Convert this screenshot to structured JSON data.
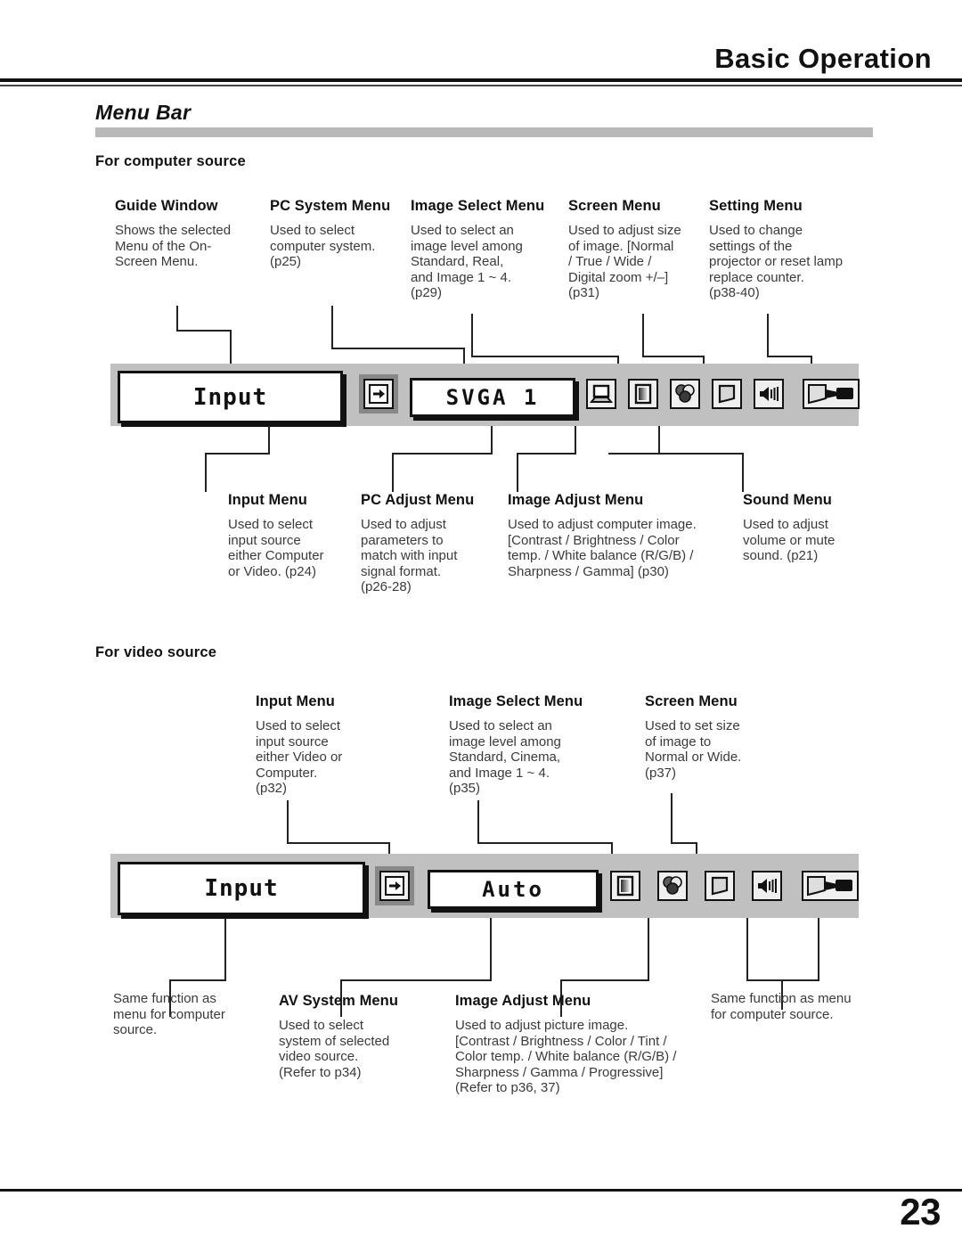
{
  "header": {
    "title": "Basic Operation"
  },
  "section": {
    "title": "Menu Bar"
  },
  "computer_section": {
    "heading": "For computer source",
    "top_callouts": [
      {
        "title": "Guide Window",
        "body": "Shows the selected\nMenu of the On-\nScreen Menu."
      },
      {
        "title": "PC System Menu",
        "body": "Used to select\ncomputer system.\n(p25)"
      },
      {
        "title": "Image Select Menu",
        "body": "Used to select  an\nimage level among\nStandard, Real,\nand Image 1 ~ 4.\n(p29)"
      },
      {
        "title": "Screen Menu",
        "body": "Used to adjust size\nof image.  [Normal\n/ True / Wide /\nDigital zoom +/–]\n(p31)"
      },
      {
        "title": "Setting Menu",
        "body": "Used to change\nsettings of the\nprojector or reset  lamp\nreplace counter.\n(p38-40)"
      }
    ],
    "bottom_callouts": [
      {
        "title": "Input Menu",
        "body": "Used to select\ninput source\neither Computer\nor Video.  (p24)"
      },
      {
        "title": "PC Adjust Menu",
        "body": "Used to adjust\nparameters to\nmatch with input\nsignal format.\n(p26-28)"
      },
      {
        "title": "Image Adjust Menu",
        "body": "Used to adjust computer image.\n[Contrast / Brightness / Color\ntemp. /  White balance (R/G/B) /\nSharpness /  Gamma]   (p30)"
      },
      {
        "title": "Sound Menu",
        "body": "Used to adjust\nvolume or mute\nsound.  (p21)"
      }
    ],
    "menu_bar": {
      "guide_label": "Input",
      "value_label": "SVGA 1",
      "icons": [
        "input-source-icon",
        "pc-system-computer-icon",
        "image-select-icon",
        "image-adjust-color-icon",
        "screen-size-icon",
        "sound-speaker-icon",
        "setting-projector-icon"
      ]
    }
  },
  "video_section": {
    "heading": "For video source",
    "top_callouts": [
      {
        "title": "Input Menu",
        "body": "Used to select\ninput source\neither Video or\nComputer.\n(p32)"
      },
      {
        "title": "Image Select Menu",
        "body": "Used to select an\nimage level among\nStandard, Cinema,\nand Image 1 ~ 4.\n(p35)"
      },
      {
        "title": "Screen Menu",
        "body": "Used to set size\nof image to\nNormal or Wide.\n(p37)"
      }
    ],
    "bottom_callouts": [
      {
        "title": "",
        "body": "Same function as\nmenu for computer\nsource."
      },
      {
        "title": "AV System Menu",
        "body": "Used to select\nsystem of selected\nvideo source.\n(Refer to p34)"
      },
      {
        "title": "Image Adjust Menu",
        "body": " Used to adjust picture image.\n[Contrast / Brightness / Color / Tint /\nColor temp. / White balance (R/G/B) /\nSharpness /  Gamma / Progressive]\n (Refer to p36, 37)"
      },
      {
        "title": "",
        "body": "Same function as menu\nfor computer source."
      }
    ],
    "menu_bar": {
      "guide_label": "Input",
      "value_label": "Auto",
      "icons": [
        "input-source-icon",
        "image-select-icon",
        "image-adjust-color-icon",
        "screen-size-icon",
        "sound-speaker-icon",
        "setting-projector-icon"
      ]
    }
  },
  "footer": {
    "page_number": "23"
  },
  "colors": {
    "rule": "#111111",
    "section_bar": "#b9b9b9",
    "osd_background": "#c0c0c0",
    "body_text": "#3a3a3a"
  }
}
